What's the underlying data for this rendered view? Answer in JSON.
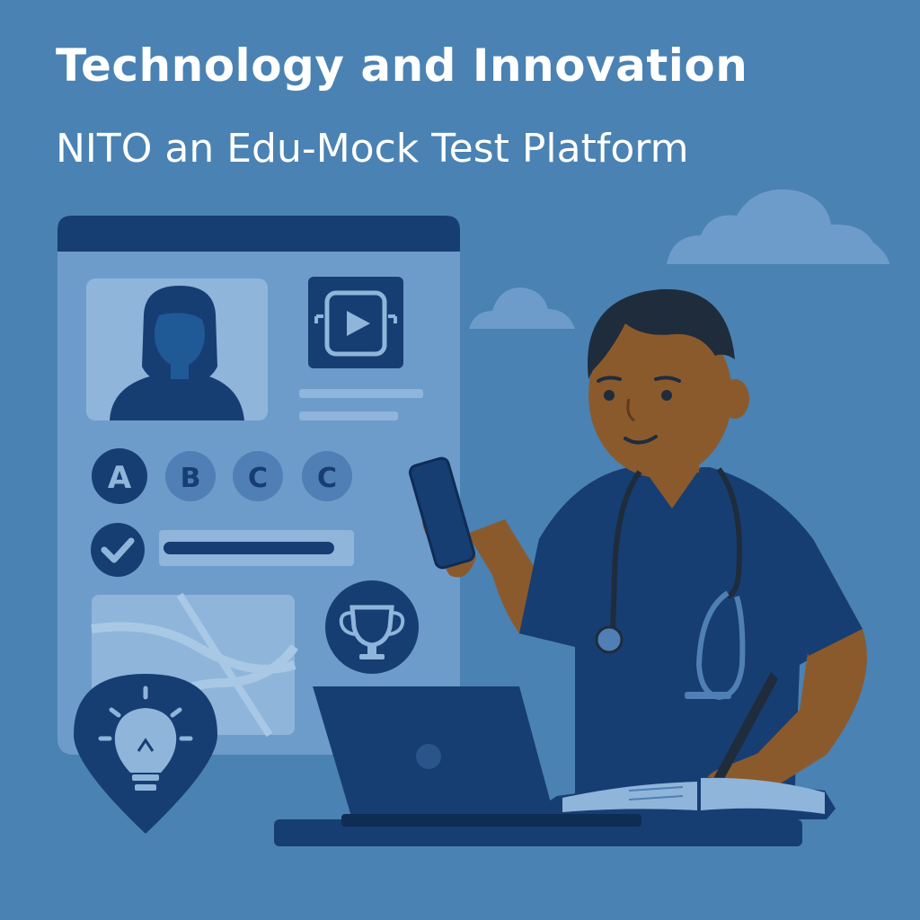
{
  "header": {
    "title": "Technology and Innovation",
    "subtitle": "NITO an Edu-Mock Test Platform"
  },
  "quiz": {
    "options": [
      "A",
      "B",
      "C",
      "C"
    ]
  },
  "icons": [
    "user-avatar-icon",
    "video-play-icon",
    "checkmark-icon",
    "trophy-icon",
    "lightbulb-icon",
    "cloud-icon",
    "map-icon"
  ],
  "colors": {
    "background": "#4a82b3",
    "panel": "#6d9ccb",
    "dark_navy": "#163e73",
    "mid_blue": "#4f7fb4",
    "light_panel": "#8fb5da",
    "skin": "#8a5a2d",
    "hair": "#1f2c3c"
  }
}
